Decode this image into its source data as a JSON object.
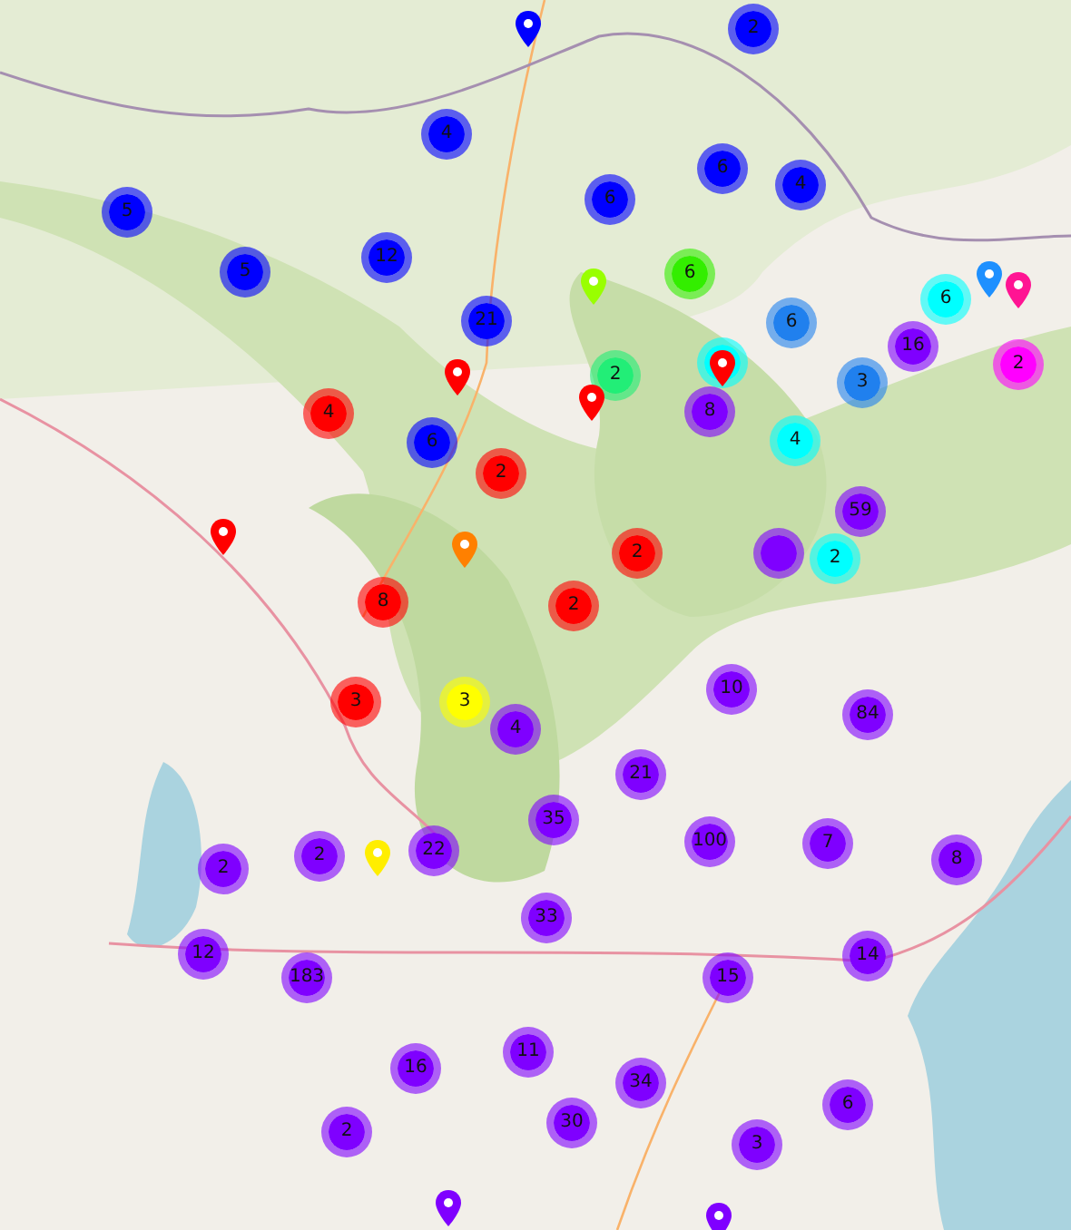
{
  "markers": [
    {
      "kind": "pin",
      "color": "#0000ff"
    },
    {
      "kind": "cluster",
      "count": "2",
      "color": "#0000ff"
    },
    {
      "kind": "cluster",
      "count": "4",
      "color": "#0000ff"
    },
    {
      "kind": "cluster",
      "count": "6",
      "color": "#0000ff"
    },
    {
      "kind": "cluster",
      "count": "4",
      "color": "#0000ff"
    },
    {
      "kind": "cluster",
      "count": "6",
      "color": "#0000ff"
    },
    {
      "kind": "cluster",
      "count": "5",
      "color": "#0000ff"
    },
    {
      "kind": "cluster",
      "count": "12",
      "color": "#0000ff"
    },
    {
      "kind": "cluster",
      "count": "5",
      "color": "#0000ff"
    },
    {
      "kind": "pin",
      "color": "#99ff00"
    },
    {
      "kind": "cluster",
      "count": "6",
      "color": "#33ee00"
    },
    {
      "kind": "pin",
      "color": "#1e90ff"
    },
    {
      "kind": "pin",
      "color": "#ff1493"
    },
    {
      "kind": "cluster",
      "count": "6",
      "color": "#00ffff"
    },
    {
      "kind": "cluster",
      "count": "21",
      "color": "#0000ff"
    },
    {
      "kind": "cluster",
      "count": "6",
      "color": "#2080ee"
    },
    {
      "kind": "cluster",
      "count": "16",
      "color": "#7f00ff"
    },
    {
      "kind": "cluster",
      "color": "#00ffff"
    },
    {
      "kind": "pin",
      "color": "#ff0000"
    },
    {
      "kind": "cluster",
      "count": "2",
      "color": "#ff00ff"
    },
    {
      "kind": "pin",
      "color": "#ff0000"
    },
    {
      "kind": "cluster",
      "count": "2",
      "color": "#22ee77"
    },
    {
      "kind": "cluster",
      "count": "3",
      "color": "#2080ee"
    },
    {
      "kind": "pin",
      "color": "#ff0000"
    },
    {
      "kind": "cluster",
      "count": "4",
      "color": "#ff0000"
    },
    {
      "kind": "cluster",
      "count": "8",
      "color": "#7f00ff"
    },
    {
      "kind": "cluster",
      "count": "6",
      "color": "#0000ff"
    },
    {
      "kind": "cluster",
      "count": "4",
      "color": "#00ffff"
    },
    {
      "kind": "cluster",
      "count": "2",
      "color": "#ff0000"
    },
    {
      "kind": "cluster",
      "count": "59",
      "color": "#7f00ff"
    },
    {
      "kind": "pin",
      "color": "#ff0000"
    },
    {
      "kind": "pin",
      "color": "#ff8000"
    },
    {
      "kind": "cluster",
      "count": "2",
      "color": "#ff0000"
    },
    {
      "kind": "cluster",
      "color": "#7f00ff"
    },
    {
      "kind": "cluster",
      "count": "2",
      "color": "#00ffff"
    },
    {
      "kind": "cluster",
      "count": "8",
      "color": "#ff0000"
    },
    {
      "kind": "cluster",
      "count": "2",
      "color": "#ff0000"
    },
    {
      "kind": "cluster",
      "count": "10",
      "color": "#7f00ff"
    },
    {
      "kind": "cluster",
      "count": "3",
      "color": "#ff0000"
    },
    {
      "kind": "cluster",
      "count": "3",
      "color": "#ffff00"
    },
    {
      "kind": "cluster",
      "count": "84",
      "color": "#7f00ff"
    },
    {
      "kind": "cluster",
      "count": "4",
      "color": "#7f00ff"
    },
    {
      "kind": "cluster",
      "count": "21",
      "color": "#7f00ff"
    },
    {
      "kind": "cluster",
      "count": "35",
      "color": "#7f00ff"
    },
    {
      "kind": "cluster",
      "count": "100",
      "color": "#7f00ff"
    },
    {
      "kind": "cluster",
      "count": "7",
      "color": "#7f00ff"
    },
    {
      "kind": "cluster",
      "count": "22",
      "color": "#7f00ff"
    },
    {
      "kind": "cluster",
      "count": "2",
      "color": "#7f00ff"
    },
    {
      "kind": "pin",
      "color": "#ffee00"
    },
    {
      "kind": "cluster",
      "count": "8",
      "color": "#7f00ff"
    },
    {
      "kind": "cluster",
      "count": "2",
      "color": "#7f00ff"
    },
    {
      "kind": "cluster",
      "count": "33",
      "color": "#7f00ff"
    },
    {
      "kind": "cluster",
      "count": "12",
      "color": "#7f00ff"
    },
    {
      "kind": "cluster",
      "count": "14",
      "color": "#7f00ff"
    },
    {
      "kind": "cluster",
      "count": "183",
      "color": "#7f00ff"
    },
    {
      "kind": "cluster",
      "count": "15",
      "color": "#7f00ff"
    },
    {
      "kind": "cluster",
      "count": "11",
      "color": "#7f00ff"
    },
    {
      "kind": "cluster",
      "count": "16",
      "color": "#7f00ff"
    },
    {
      "kind": "cluster",
      "count": "34",
      "color": "#7f00ff"
    },
    {
      "kind": "cluster",
      "count": "6",
      "color": "#7f00ff"
    },
    {
      "kind": "cluster",
      "count": "30",
      "color": "#7f00ff"
    },
    {
      "kind": "cluster",
      "count": "2",
      "color": "#7f00ff"
    },
    {
      "kind": "cluster",
      "count": "3",
      "color": "#7f00ff"
    },
    {
      "kind": "pin",
      "color": "#7f00ff"
    },
    {
      "kind": "pin",
      "color": "#7f00ff"
    }
  ]
}
